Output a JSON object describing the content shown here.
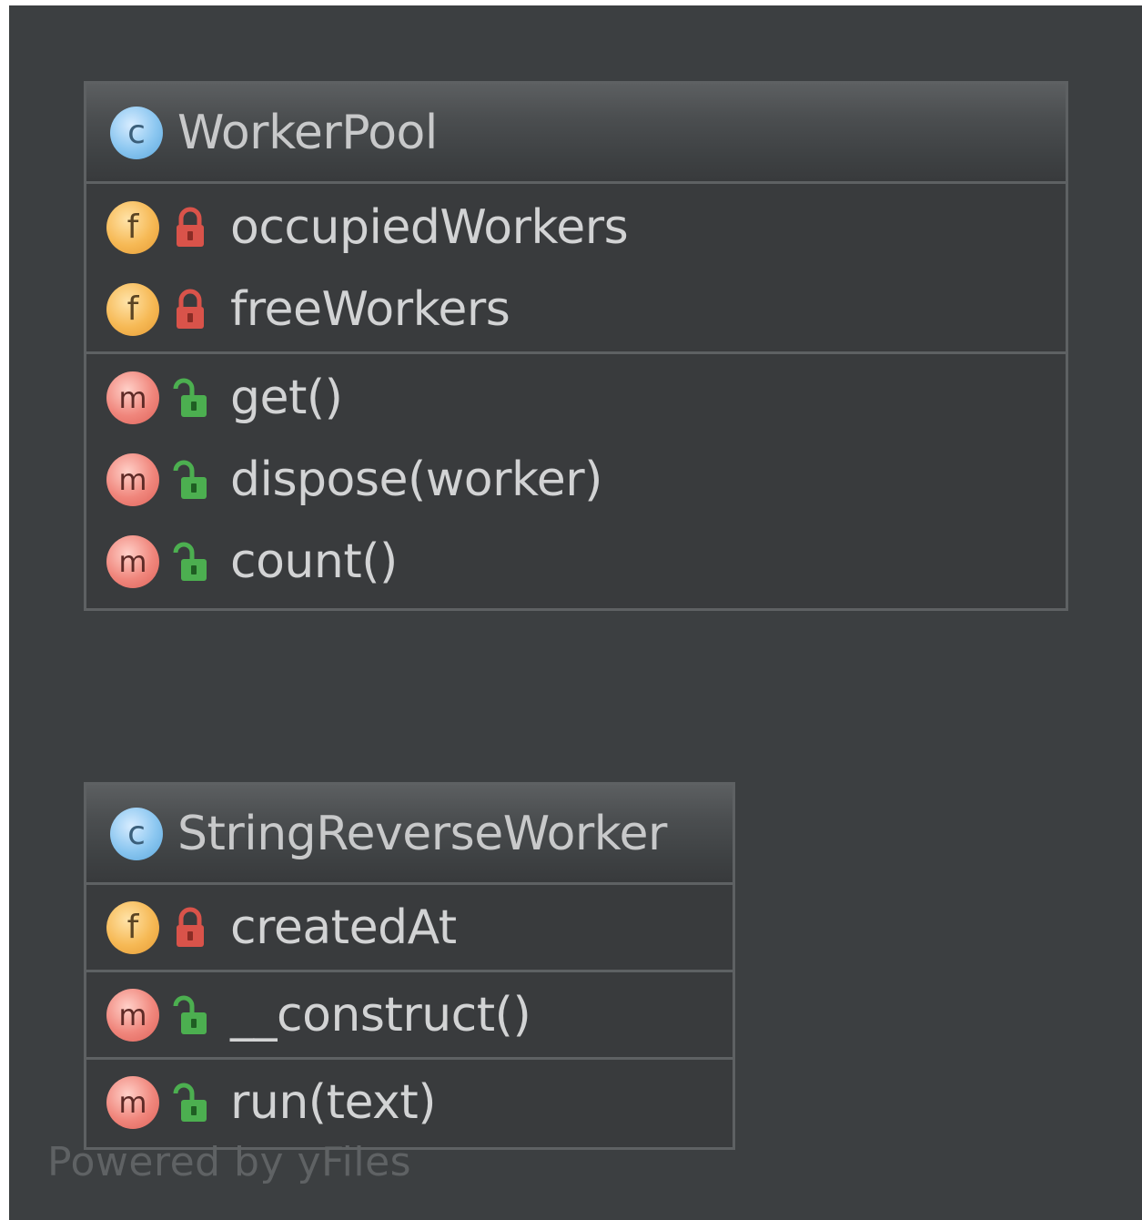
{
  "classes": [
    {
      "name": "WorkerPool",
      "badge": "c",
      "fields": [
        {
          "badge": "f",
          "visibility": "private",
          "name": "occupiedWorkers"
        },
        {
          "badge": "f",
          "visibility": "private",
          "name": "freeWorkers"
        }
      ],
      "methods": [
        {
          "badge": "m",
          "visibility": "public",
          "name": "get()"
        },
        {
          "badge": "m",
          "visibility": "public",
          "name": "dispose(worker)"
        },
        {
          "badge": "m",
          "visibility": "public",
          "name": "count()"
        }
      ]
    },
    {
      "name": "StringReverseWorker",
      "badge": "c",
      "fields": [
        {
          "badge": "f",
          "visibility": "private",
          "name": "createdAt"
        }
      ],
      "method_sections": [
        [
          {
            "badge": "m",
            "visibility": "public",
            "name": "__construct()"
          }
        ],
        [
          {
            "badge": "m",
            "visibility": "public",
            "name": "run(text)"
          }
        ]
      ]
    }
  ],
  "icons": {
    "class": "class-icon",
    "field": "field-icon",
    "method": "method-icon",
    "private": "lock-closed-icon",
    "public": "lock-open-icon"
  },
  "colors": {
    "background": "#3c3f41",
    "private_lock": "#d9534a",
    "public_lock": "#4caf50"
  },
  "watermark": "Powered by yFiles"
}
